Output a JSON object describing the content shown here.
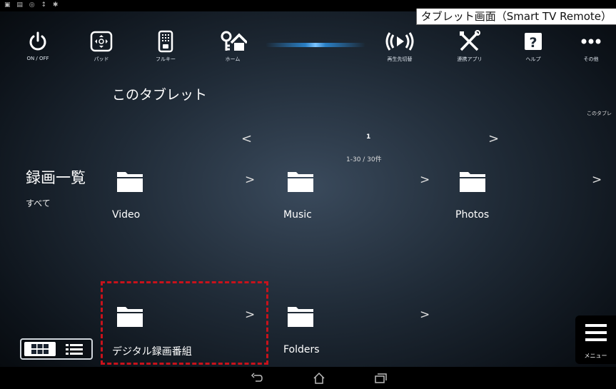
{
  "caption": "タブレット画面（Smart TV Remote）",
  "toolbar": {
    "items": [
      {
        "label": "ON / OFF",
        "icon": "power-icon"
      },
      {
        "label": "パッド",
        "icon": "dpad-icon"
      },
      {
        "label": "フルキー",
        "icon": "remote-icon"
      },
      {
        "label": "ホーム",
        "icon": "home-icon"
      },
      {
        "label": "再生先切替",
        "icon": "play-switch-icon"
      },
      {
        "label": "連携アプリ",
        "icon": "tools-icon"
      },
      {
        "label": "ヘルプ",
        "icon": "help-icon"
      },
      {
        "label": "その他",
        "icon": "more-icon"
      }
    ]
  },
  "device_title": "このタブレット",
  "right_label": "このタブレ",
  "pager": {
    "prev": "<",
    "next": ">",
    "page": "1",
    "range": "1-30 / 30件"
  },
  "sidebar": {
    "title": "録画一覧",
    "filter": "すべて"
  },
  "folders": [
    {
      "name": "Video",
      "chevron": ">"
    },
    {
      "name": "Music",
      "chevron": ">"
    },
    {
      "name": "Photos",
      "chevron": ">"
    },
    {
      "name": "デジタル録画番組",
      "chevron": ">"
    },
    {
      "name": "Folders",
      "chevron": ">"
    }
  ],
  "menu_button": {
    "label": "メニュー"
  },
  "colors": {
    "highlight": "#c8121b",
    "accent_blue": "#2a7fc4"
  }
}
